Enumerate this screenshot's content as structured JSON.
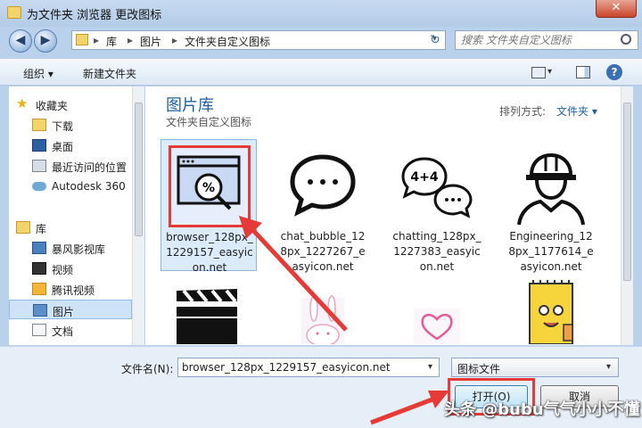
{
  "window": {
    "title": "为文件夹 浏览器 更改图标",
    "close_glyph": "✕"
  },
  "nav": {
    "back_glyph": "◀",
    "forward_glyph": "▶",
    "breadcrumb": [
      "库",
      "图片",
      "文件夹自定义图标"
    ],
    "refresh_glyph": "↻",
    "search_placeholder": "搜索 文件夹自定义图标"
  },
  "toolbar": {
    "organize": "组织 ▾",
    "new_folder": "新建文件夹"
  },
  "sidebar": {
    "favorites": {
      "label": "收藏夹",
      "icon": "star-icon"
    },
    "fav_items": [
      {
        "label": "下载",
        "icon": "download-folder-icon"
      },
      {
        "label": "桌面",
        "icon": "desktop-icon"
      },
      {
        "label": "最近访问的位置",
        "icon": "recent-places-icon"
      },
      {
        "label": "Autodesk 360",
        "icon": "cloud-icon"
      }
    ],
    "libraries": {
      "label": "库",
      "icon": "library-icon"
    },
    "lib_items": [
      {
        "label": "暴风影视库",
        "icon": "video-library-icon"
      },
      {
        "label": "视频",
        "icon": "video-icon"
      },
      {
        "label": "腾讯视频",
        "icon": "folder-icon"
      },
      {
        "label": "图片",
        "icon": "pictures-icon"
      },
      {
        "label": "文档",
        "icon": "documents-icon"
      }
    ]
  },
  "content": {
    "library_title": "图片库",
    "library_subtitle": "文件夹自定义图标",
    "arrange_label": "排列方式:",
    "arrange_value": "文件夹 ▾",
    "files": [
      {
        "name": [
          "browser_128px_",
          "1229157_easyic",
          "on.net"
        ],
        "icon": "browser-search-icon",
        "selected": true
      },
      {
        "name": [
          "chat_bubble_12",
          "8px_1227267_e",
          "asyicon.net"
        ],
        "icon": "chat-bubble-icon"
      },
      {
        "name": [
          "chatting_128px_",
          "1227383_easyic",
          "on.net"
        ],
        "icon": "chatting-icon"
      },
      {
        "name": [
          "Engineering_12",
          "8px_1177614_e",
          "asyicon.net"
        ],
        "icon": "engineer-icon"
      },
      {
        "name": [],
        "icon": "clapperboard-icon"
      },
      {
        "name": [],
        "icon": "bunny-icon"
      },
      {
        "name": [],
        "icon": "heart-icon"
      },
      {
        "name": [],
        "icon": "notepad-character-icon"
      }
    ]
  },
  "footer": {
    "filename_label": "文件名(N):",
    "filename_value": "browser_128px_1229157_easyicon.net",
    "filetype_value": "图标文件",
    "open_label": "打开(O)",
    "cancel_label": "取消"
  },
  "watermark": "头条 @bubu气气小小不懂",
  "colors": {
    "highlight": "#e53a35",
    "accent": "#1f5f9f"
  }
}
